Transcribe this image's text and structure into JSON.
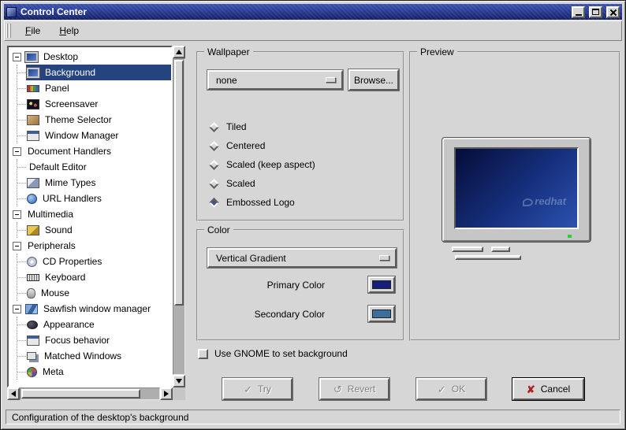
{
  "window": {
    "title": "Control Center"
  },
  "menubar": {
    "items": [
      {
        "label": "File"
      },
      {
        "label": "Help"
      }
    ]
  },
  "tree": {
    "items": [
      {
        "label": "Desktop",
        "depth": 0,
        "branch": true,
        "icon": "desktop-icon"
      },
      {
        "label": "Background",
        "depth": 1,
        "selected": true,
        "icon": "background-icon"
      },
      {
        "label": "Panel",
        "depth": 1,
        "icon": "panel-icon"
      },
      {
        "label": "Screensaver",
        "depth": 1,
        "icon": "screensaver-icon"
      },
      {
        "label": "Theme Selector",
        "depth": 1,
        "icon": "theme-selector-icon"
      },
      {
        "label": "Window Manager",
        "depth": 1,
        "icon": "window-manager-icon"
      },
      {
        "label": "Document Handlers",
        "depth": 0,
        "branch": true
      },
      {
        "label": "Default Editor",
        "depth": 1
      },
      {
        "label": "Mime Types",
        "depth": 1,
        "icon": "mime-types-icon"
      },
      {
        "label": "URL Handlers",
        "depth": 1,
        "icon": "url-handlers-icon"
      },
      {
        "label": "Multimedia",
        "depth": 0,
        "branch": true
      },
      {
        "label": "Sound",
        "depth": 1,
        "icon": "sound-icon"
      },
      {
        "label": "Peripherals",
        "depth": 0,
        "branch": true
      },
      {
        "label": "CD Properties",
        "depth": 1,
        "icon": "cd-properties-icon"
      },
      {
        "label": "Keyboard",
        "depth": 1,
        "icon": "keyboard-icon"
      },
      {
        "label": "Mouse",
        "depth": 1,
        "icon": "mouse-icon"
      },
      {
        "label": "Sawfish window manager",
        "depth": 0,
        "branch": true,
        "icon": "sawfish-icon"
      },
      {
        "label": "Appearance",
        "depth": 1,
        "icon": "appearance-icon"
      },
      {
        "label": "Focus behavior",
        "depth": 1,
        "icon": "focus-behavior-icon"
      },
      {
        "label": "Matched Windows",
        "depth": 1,
        "icon": "matched-windows-icon"
      },
      {
        "label": "Meta",
        "depth": 1,
        "icon": "meta-icon"
      }
    ]
  },
  "wallpaper": {
    "legend": "Wallpaper",
    "dropdown_value": "none",
    "browse_label": "Browse...",
    "options": [
      {
        "label": "Tiled",
        "selected": false
      },
      {
        "label": "Centered",
        "selected": false
      },
      {
        "label": "Scaled (keep aspect)",
        "selected": false
      },
      {
        "label": "Scaled",
        "selected": false
      },
      {
        "label": "Embossed Logo",
        "selected": true
      }
    ]
  },
  "color": {
    "legend": "Color",
    "dropdown_value": "Vertical Gradient",
    "primary_label": "Primary Color",
    "secondary_label": "Secondary Color",
    "primary_color": "#141f7a",
    "secondary_color": "#3d6e9e"
  },
  "preview": {
    "legend": "Preview",
    "logo_text": "redhat"
  },
  "background_checkbox": {
    "label": "Use GNOME to set background",
    "checked": false
  },
  "actions": {
    "try": {
      "label": "Try",
      "enabled": false
    },
    "revert": {
      "label": "Revert",
      "enabled": false
    },
    "ok": {
      "label": "OK",
      "enabled": false
    },
    "cancel": {
      "label": "Cancel",
      "enabled": true
    }
  },
  "icons": {
    "try": "✓",
    "revert": "↺",
    "ok": "✓",
    "cancel": "✘"
  },
  "statusbar": {
    "text": "Configuration of the desktop's background"
  }
}
